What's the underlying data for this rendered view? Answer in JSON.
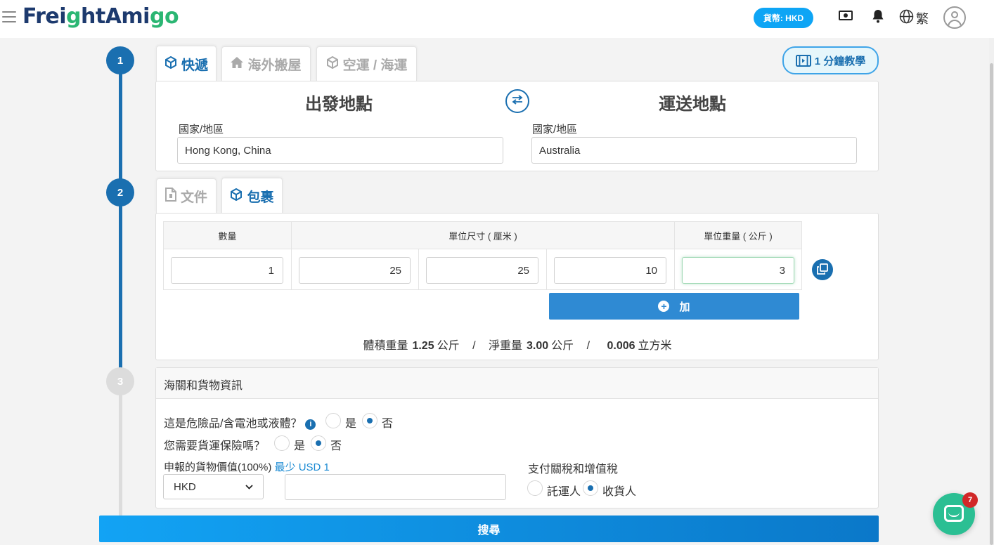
{
  "header": {
    "logo_part1": "Fre",
    "logo_i": "i",
    "logo_g": "g",
    "logo_part2": "htAmi",
    "logo_g2": "g",
    "logo_part3": "o",
    "currency_label": "貨幣: HKD",
    "language": "繁"
  },
  "steps": [
    "1",
    "2",
    "3"
  ],
  "service_tabs": [
    {
      "label": "快遞",
      "icon": "box-icon",
      "active": true
    },
    {
      "label": "海外搬屋",
      "icon": "home-icon",
      "active": false
    },
    {
      "label": "空運 / 海運",
      "icon": "box-icon",
      "active": false
    }
  ],
  "tutorial_label": "1 分鐘教學",
  "route": {
    "origin_title": "出發地點",
    "destination_title": "運送地點",
    "origin_label": "國家/地區",
    "origin_value": "Hong Kong, China",
    "destination_label": "國家/地區",
    "destination_value": "Australia"
  },
  "package_tabs": [
    {
      "label": "文件",
      "icon": "document-icon",
      "active": false
    },
    {
      "label": "包裹",
      "icon": "box-icon",
      "active": true
    }
  ],
  "package_table": {
    "headers": {
      "quantity": "數量",
      "dimensions": "單位尺寸 ( 厘米 )",
      "weight": "單位重量 ( 公斤 )"
    },
    "row": {
      "quantity": "1",
      "length": "25",
      "width": "25",
      "height": "10",
      "weight": "3"
    },
    "add_label": "加"
  },
  "summary": {
    "vol_label": "體積重量",
    "vol_value": "1.25",
    "vol_unit": "公斤",
    "net_label": "淨重量",
    "net_value": "3.00",
    "net_unit": "公斤",
    "cbm_value": "0.006",
    "cbm_unit": "立方米",
    "separator": "/"
  },
  "customs": {
    "title": "海關和貨物資訊",
    "dangerous_q": "這是危險品/含電池或液體？",
    "insurance_q": "您需要貨運保險嗎？",
    "yes": "是",
    "no": "否",
    "declared_label": "申報的貨物價值(100%)",
    "declared_min": "最少 USD 1",
    "currency_selected": "HKD",
    "declared_value": "",
    "duties_label": "支付關稅和增值稅",
    "shipper": "託運人",
    "receiver": "收貨人"
  },
  "search_label": "搜尋",
  "chat_badge": "7",
  "colors": {
    "primary": "#1a6fb0",
    "accent": "#0ea5f5",
    "chat": "#2bbf93",
    "badge": "#d12828"
  }
}
